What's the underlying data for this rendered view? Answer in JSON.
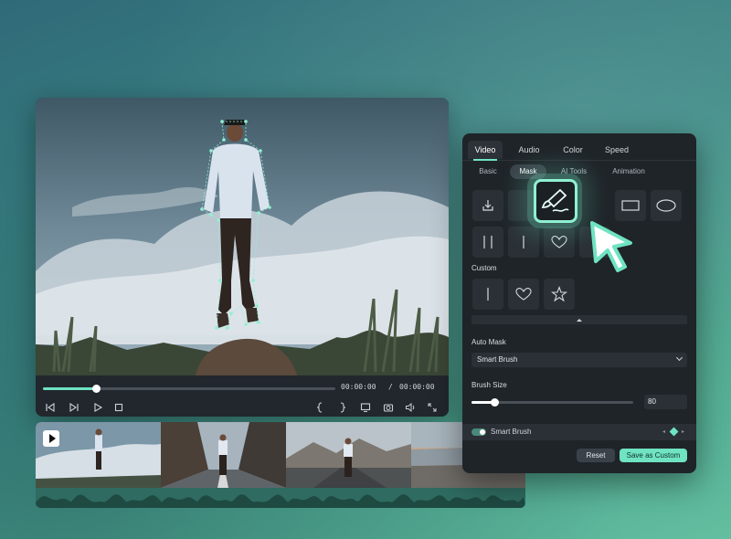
{
  "player": {
    "progress": 0.18,
    "current_time": "00:00:00",
    "separator": "/",
    "total_time": "00:00:00",
    "controls": [
      "prev-frame-icon",
      "next-frame-icon",
      "play-icon",
      "stop-icon",
      "mark-in-icon",
      "mark-out-icon",
      "display-icon",
      "snapshot-icon",
      "volume-icon",
      "fullscreen-icon"
    ]
  },
  "panel": {
    "tabs": [
      "Video",
      "Audio",
      "Color",
      "Speed"
    ],
    "active_tab": "Video",
    "subtabs": [
      "Basic",
      "Mask",
      "AI Tools",
      "Animation"
    ],
    "active_subtab": "Mask",
    "custom_label": "Custom",
    "auto_mask_label": "Auto Mask",
    "auto_mask_value": "Smart Brush",
    "brush_size_label": "Brush Size",
    "brush_size_value": "80",
    "brush_size_fraction": 0.14,
    "smart_brush_label": "Smart Brush",
    "reset_label": "Reset",
    "save_label": "Save as Custom"
  },
  "colors": {
    "accent": "#6fe3c2",
    "panel_bg": "#1f2429"
  }
}
